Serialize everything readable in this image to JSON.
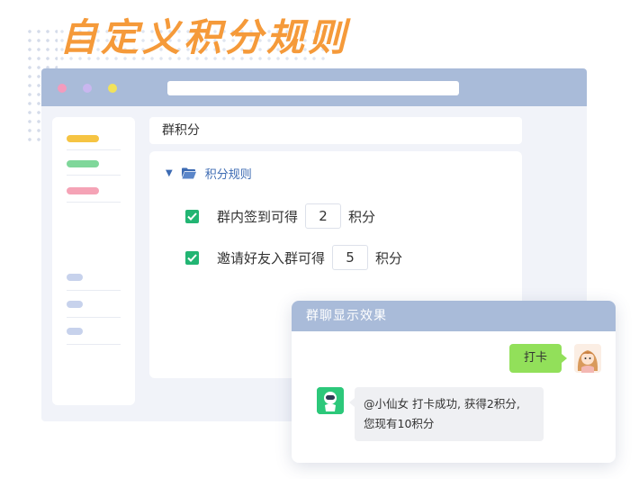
{
  "hero": {
    "title": "自定义积分规则"
  },
  "window": {
    "header_title": "群积分",
    "tree": {
      "folder_label": "积分规则"
    },
    "rules": [
      {
        "prefix": "群内签到可得",
        "value": "2",
        "suffix": "积分",
        "checked": true
      },
      {
        "prefix": "邀请好友入群可得",
        "value": "5",
        "suffix": "积分",
        "checked": true
      }
    ]
  },
  "chat": {
    "title": "群聊显示效果",
    "user_message": "打卡",
    "bot_message_line1": "@小仙女 打卡成功, 获得2积分,",
    "bot_message_line2": "您现有10积分"
  },
  "colors": {
    "title_orange": "#f59a3a",
    "titlebar_blue": "#a9bbd9",
    "check_green": "#22b573",
    "bubble_green": "#92e05a",
    "link_blue": "#3d6bb3"
  }
}
